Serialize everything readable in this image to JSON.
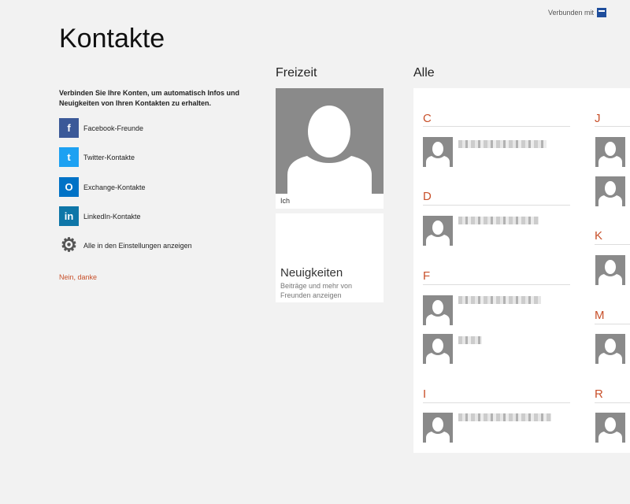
{
  "header": {
    "title": "Kontakte",
    "connected_label": "Verbunden mit"
  },
  "intro_text": "Verbinden Sie Ihre Konten, um automatisch Infos und Neuigkeiten von Ihren Kontakten zu erhalten.",
  "accounts": [
    {
      "label": "Facebook-Freunde",
      "icon": "facebook-icon",
      "color": "#3b5998",
      "glyph": "f"
    },
    {
      "label": "Twitter-Kontakte",
      "icon": "twitter-icon",
      "color": "#1da1f2",
      "glyph": "t"
    },
    {
      "label": "Exchange-Kontakte",
      "icon": "exchange-icon",
      "color": "#0072c6",
      "glyph": "O"
    },
    {
      "label": "LinkedIn-Kontakte",
      "icon": "linkedin-icon",
      "color": "#0e76a8",
      "glyph": "in"
    },
    {
      "label": "Alle in den Einstellungen anzeigen",
      "icon": "gear-icon",
      "color": "#555555",
      "glyph": "⚙"
    }
  ],
  "no_thanks": "Nein, danke",
  "freizeit": {
    "heading": "Freizeit",
    "me_caption": "Ich",
    "news_title": "Neuigkeiten",
    "news_subtitle": "Beiträge und mehr von Freunden anzeigen"
  },
  "all": {
    "heading": "Alle",
    "letters": [
      "C",
      "D",
      "F",
      "I",
      "J",
      "K",
      "M",
      "R"
    ]
  },
  "colors": {
    "accent": "#c8502a",
    "background": "#f2f2f2",
    "avatar": "#8a8a8a"
  }
}
